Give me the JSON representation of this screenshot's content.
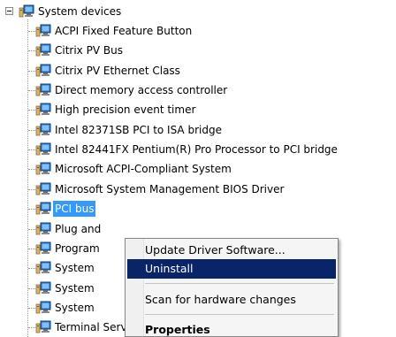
{
  "tree": {
    "root_label": "System devices",
    "items": [
      {
        "label": "ACPI Fixed Feature Button"
      },
      {
        "label": "Citrix PV Bus"
      },
      {
        "label": "Citrix PV Ethernet Class"
      },
      {
        "label": "Direct memory access controller"
      },
      {
        "label": "High precision event timer"
      },
      {
        "label": "Intel 82371SB PCI to ISA bridge"
      },
      {
        "label": "Intel 82441FX Pentium(R) Pro Processor to PCI bridge"
      },
      {
        "label": "Microsoft ACPI-Compliant System"
      },
      {
        "label": "Microsoft System Management BIOS Driver"
      },
      {
        "label": "PCI bus",
        "selected": true
      },
      {
        "label": "Plug and"
      },
      {
        "label": "Program"
      },
      {
        "label": "System"
      },
      {
        "label": "System"
      },
      {
        "label": "System"
      },
      {
        "label": "Terminal Server Device Redirector"
      }
    ]
  },
  "context_menu": {
    "items": [
      {
        "label": "Update Driver Software...",
        "type": "item"
      },
      {
        "label": "Uninstall",
        "type": "item",
        "highlighted": true
      },
      {
        "type": "separator"
      },
      {
        "label": "Scan for hardware changes",
        "type": "item"
      },
      {
        "type": "separator"
      },
      {
        "label": "Properties",
        "type": "item",
        "bold": true
      }
    ]
  },
  "colors": {
    "selection": "#3399ff",
    "menu_highlight": "#0a246a",
    "menu_background": "#f5f5f5",
    "tree_line": "#9a9a9a"
  },
  "icons": {
    "root": "system-devices-icon",
    "item": "device-icon",
    "expander": "collapse-minus-icon"
  }
}
